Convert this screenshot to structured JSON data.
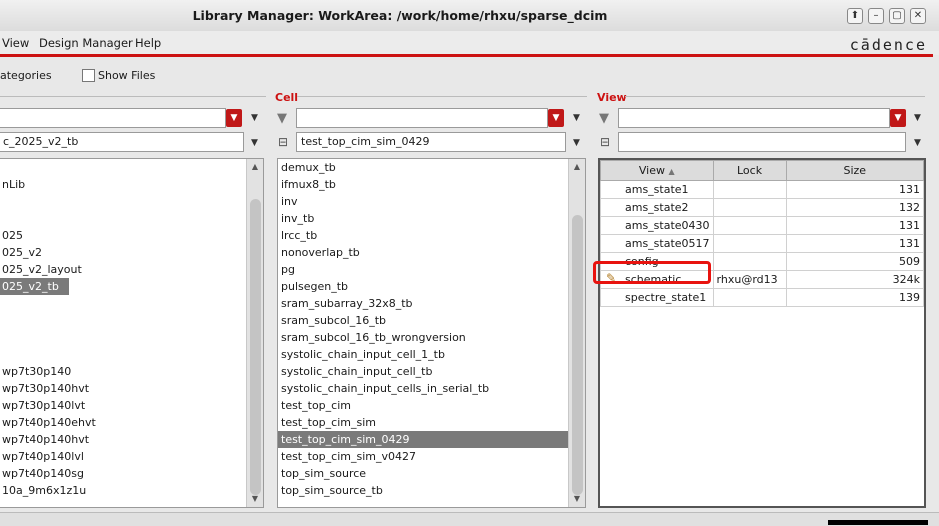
{
  "window": {
    "title": "Library Manager: WorkArea:  /work/home/rhxu/sparse_dcim"
  },
  "window_buttons": [
    "⬆",
    "–",
    "▢",
    "✕"
  ],
  "menubar": {
    "items": [
      "View",
      "Design Manager",
      "Help"
    ],
    "logo": "cādence"
  },
  "options": {
    "categories_label": "ategories",
    "show_files_label": "Show Files"
  },
  "library_pane": {
    "filter_value": "c_2025_v2_tb",
    "items": [
      "",
      "nLib",
      "",
      "",
      "025",
      "025_v2",
      "025_v2_layout",
      "025_v2_tb",
      "",
      "",
      "",
      "",
      "wp7t30p140",
      "wp7t30p140hvt",
      "wp7t30p140lvt",
      "wp7t40p140ehvt",
      "wp7t40p140hvt",
      "wp7t40p140lvl",
      "wp7t40p140sg",
      "10a_9m6x1z1u"
    ],
    "selected_index": 7
  },
  "cell_pane": {
    "title": "Cell",
    "filter_value": "test_top_cim_sim_0429",
    "items": [
      "demux_tb",
      "ifmux8_tb",
      "inv",
      "inv_tb",
      "lrcc_tb",
      "nonoverlap_tb",
      "pg",
      "pulsegen_tb",
      "sram_subarray_32x8_tb",
      "sram_subcol_16_tb",
      "sram_subcol_16_tb_wrongversion",
      "systolic_chain_input_cell_1_tb",
      "systolic_chain_input_cell_tb",
      "systolic_chain_input_cells_in_serial_tb",
      "test_top_cim",
      "test_top_cim_sim",
      "test_top_cim_sim_0429",
      "test_top_cim_sim_v0427",
      "top_sim_source",
      "top_sim_source_tb"
    ],
    "selected_index": 16
  },
  "view_pane": {
    "title": "View",
    "columns": [
      "View",
      "Lock",
      "Size"
    ],
    "rows": [
      {
        "view": "ams_state1",
        "lock": "",
        "size": "131"
      },
      {
        "view": "ams_state2",
        "lock": "",
        "size": "132"
      },
      {
        "view": "ams_state0430",
        "lock": "",
        "size": "131"
      },
      {
        "view": "ams_state0517",
        "lock": "",
        "size": "131"
      },
      {
        "view": "config",
        "lock": "",
        "size": "509"
      },
      {
        "view": "schematic",
        "lock": "rhxu@rd13",
        "size": "324k"
      },
      {
        "view": "spectre_state1",
        "lock": "",
        "size": "139"
      }
    ]
  },
  "colors": {
    "accent": "#cc1111",
    "highlight": "#e8130f",
    "selection": "#7a7a7a"
  }
}
